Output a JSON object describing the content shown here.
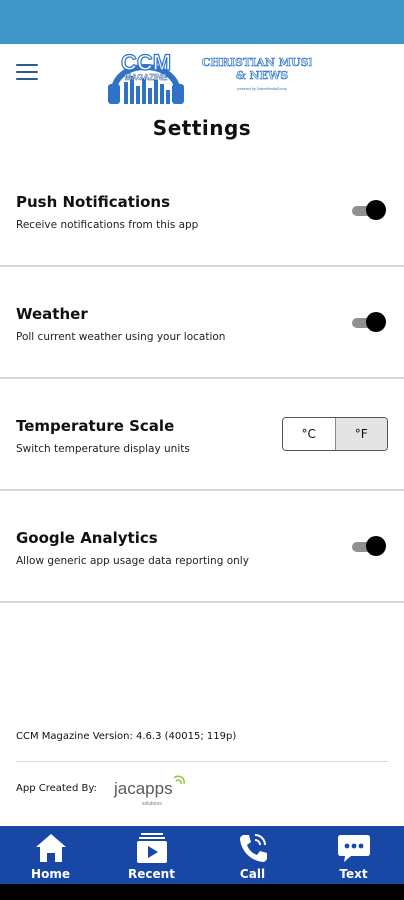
{
  "header": {
    "logo_text_main": "CCM",
    "logo_text_sub": "MAGAZINE",
    "logo_text_right_1": "CHRISTIAN MUSIC",
    "logo_text_right_2": "& NEWS",
    "logo_text_right_3": "powered by SalemMediaGroup"
  },
  "page": {
    "title": "Settings"
  },
  "settings": [
    {
      "title": "Push Notifications",
      "description": "Receive notifications from this app",
      "control": "toggle",
      "enabled": true
    },
    {
      "title": "Weather",
      "description": "Poll current weather using your location",
      "control": "toggle",
      "enabled": true
    },
    {
      "title": "Temperature Scale",
      "description": "Switch temperature display units",
      "control": "segmented",
      "options": [
        "°C",
        "°F"
      ],
      "selected": "°F"
    },
    {
      "title": "Google Analytics",
      "description": "Allow generic app usage data reporting only",
      "control": "toggle",
      "enabled": true
    }
  ],
  "footer": {
    "version": "CCM Magazine Version: 4.6.3 (40015; 119p)",
    "created_by_label": "App Created By:",
    "jacapps_brand": "jacapps",
    "jacapps_sub": "solutions"
  },
  "tabs": [
    {
      "label": "Home",
      "icon": "home-icon"
    },
    {
      "label": "Recent",
      "icon": "recent-play-icon"
    },
    {
      "label": "Call",
      "icon": "phone-icon"
    },
    {
      "label": "Text",
      "icon": "chat-bubble-icon"
    }
  ],
  "colors": {
    "status_bar": "#3f97c9",
    "tab_bar": "#1847a6",
    "logo_blue": "#2f73c6",
    "toggle_knob": "#000000",
    "toggle_track": "#8f8f8f"
  }
}
